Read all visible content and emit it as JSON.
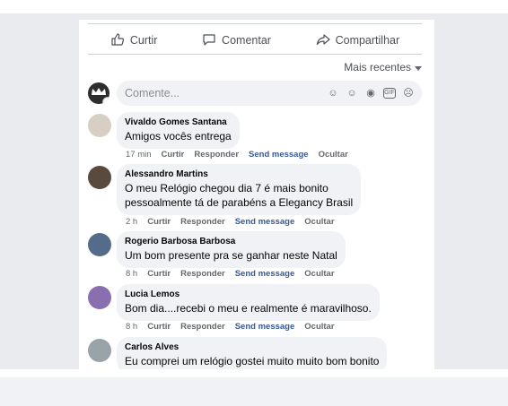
{
  "actions": {
    "like": "Curtir",
    "comment": "Comentar",
    "share": "Compartilhar"
  },
  "sort": {
    "label": "Mais recentes"
  },
  "composer": {
    "placeholder": "Comente..."
  },
  "comments": [
    {
      "name": "Vivaldo Gomes Santana",
      "text": [
        "Amigos vocês entrega"
      ],
      "time": "17 min",
      "like": "Curtir",
      "reply": "Responder",
      "send": "Send message",
      "hide": "Ocultar"
    },
    {
      "name": "Alessandro Martins",
      "text": [
        "O meu Relógio chegou dia 7 é mais bonito",
        "pessoalmente tá de parabéns a Elegancy Brasil"
      ],
      "time": "2 h",
      "like": "Curtir",
      "reply": "Responder",
      "send": "Send message",
      "hide": "Ocultar"
    },
    {
      "name": "Rogerio Barbosa Barbosa",
      "text": [
        "Um bom presente pra se ganhar neste Natal"
      ],
      "time": "8 h",
      "like": "Curtir",
      "reply": "Responder",
      "send": "Send message",
      "hide": "Ocultar"
    },
    {
      "name": "Lucia Lemos",
      "text": [
        "Bom dia....recebi o meu e realmente é maravilhoso."
      ],
      "time": "8 h",
      "like": "Curtir",
      "reply": "Responder",
      "send": "Send message",
      "hide": "Ocultar"
    },
    {
      "name": "Carlos Alves",
      "text": [
        "Eu comprei um relógio gostei muito muito bom bonito"
      ]
    }
  ]
}
